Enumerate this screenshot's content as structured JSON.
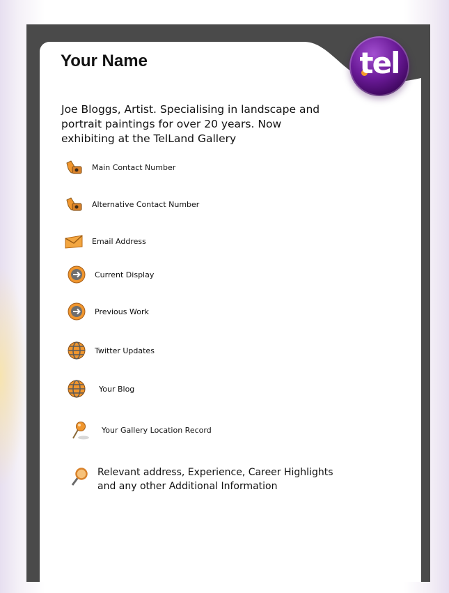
{
  "card": {
    "title": "Your Name",
    "intro": "Joe Bloggs, Artist. Specialising in landscape and portrait paintings for over 20 years. Now exhibiting at the TelLand Gallery",
    "logo_text": "tel"
  },
  "items": [
    {
      "icon": "phone-icon",
      "label": "Main Contact Number"
    },
    {
      "icon": "phone-icon",
      "label": "Alternative Contact Number"
    },
    {
      "icon": "email-envelope-icon",
      "label": "Email Address"
    },
    {
      "icon": "arrow-circle-icon",
      "label": "Current  Display"
    },
    {
      "icon": "arrow-circle-icon",
      "label": "Previous Work"
    },
    {
      "icon": "globe-icon",
      "label": "Twitter Updates"
    },
    {
      "icon": "globe-icon",
      "label": "Your Blog"
    },
    {
      "icon": "map-pin-icon",
      "label": "Your Gallery Location Record"
    },
    {
      "icon": "magnifier-icon",
      "label": "Relevant address, Experience, Career Highlights and any other Additional Information"
    }
  ],
  "colors": {
    "frame": "#4a4a4a",
    "accent_orange": "#f0962e",
    "logo_purple": "#5a1785"
  }
}
